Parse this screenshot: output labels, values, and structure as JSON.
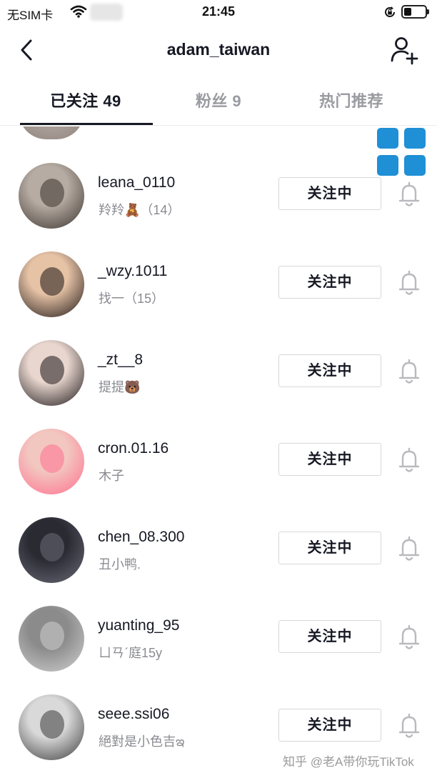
{
  "status_bar": {
    "carrier": "无SIM卡",
    "time": "21:45",
    "battery_level": 0.35,
    "icons": [
      "wifi-icon",
      "orientation-lock-icon",
      "battery-icon"
    ]
  },
  "nav": {
    "title": "adam_taiwan",
    "icons": [
      "back-icon",
      "add-user-icon"
    ]
  },
  "tabs": [
    {
      "label": "已关注 49",
      "active": true
    },
    {
      "label": "粉丝 9",
      "active": false
    },
    {
      "label": "热门推荐",
      "active": false
    }
  ],
  "floating_button": {
    "icon": "grid-icon",
    "color": "#1f8fd6"
  },
  "following": [
    {
      "username": "leana_0110",
      "subtitle": "羚羚🧸（14）",
      "button": "关注中",
      "icon": "bell-icon",
      "avatar_colors": [
        "#b7aca3",
        "#3a332f"
      ]
    },
    {
      "username": "_wzy.1011",
      "subtitle": "找一（15）",
      "button": "关注中",
      "icon": "bell-icon",
      "avatar_colors": [
        "#e7c3a6",
        "#1d1616"
      ]
    },
    {
      "username": "_zt__8",
      "subtitle": "提提🐻",
      "button": "关注中",
      "icon": "bell-icon",
      "avatar_colors": [
        "#e9d7cf",
        "#1b1618"
      ]
    },
    {
      "username": "cron.01.16",
      "subtitle": "木子",
      "button": "关注中",
      "icon": "bell-icon",
      "avatar_colors": [
        "#f2c7c0",
        "#ff6f8f"
      ]
    },
    {
      "username": "chen_08.300",
      "subtitle": "丑小鸭.",
      "button": "关注中",
      "icon": "bell-icon",
      "avatar_colors": [
        "#2a2a33",
        "#6b6b78"
      ]
    },
    {
      "username": "yuanting_95",
      "subtitle": "ㄩㄢˊ庭15y",
      "button": "关注中",
      "icon": "bell-icon",
      "avatar_colors": [
        "#8b8b8b",
        "#d0d0d0"
      ]
    },
    {
      "username": "seee.ssi06",
      "subtitle": "絕對是小色吉ఇ",
      "button": "关注中",
      "icon": "bell-icon",
      "avatar_colors": [
        "#d9d9d9",
        "#3b3b3b"
      ]
    }
  ],
  "watermark": "知乎 @老A带你玩TikTok"
}
